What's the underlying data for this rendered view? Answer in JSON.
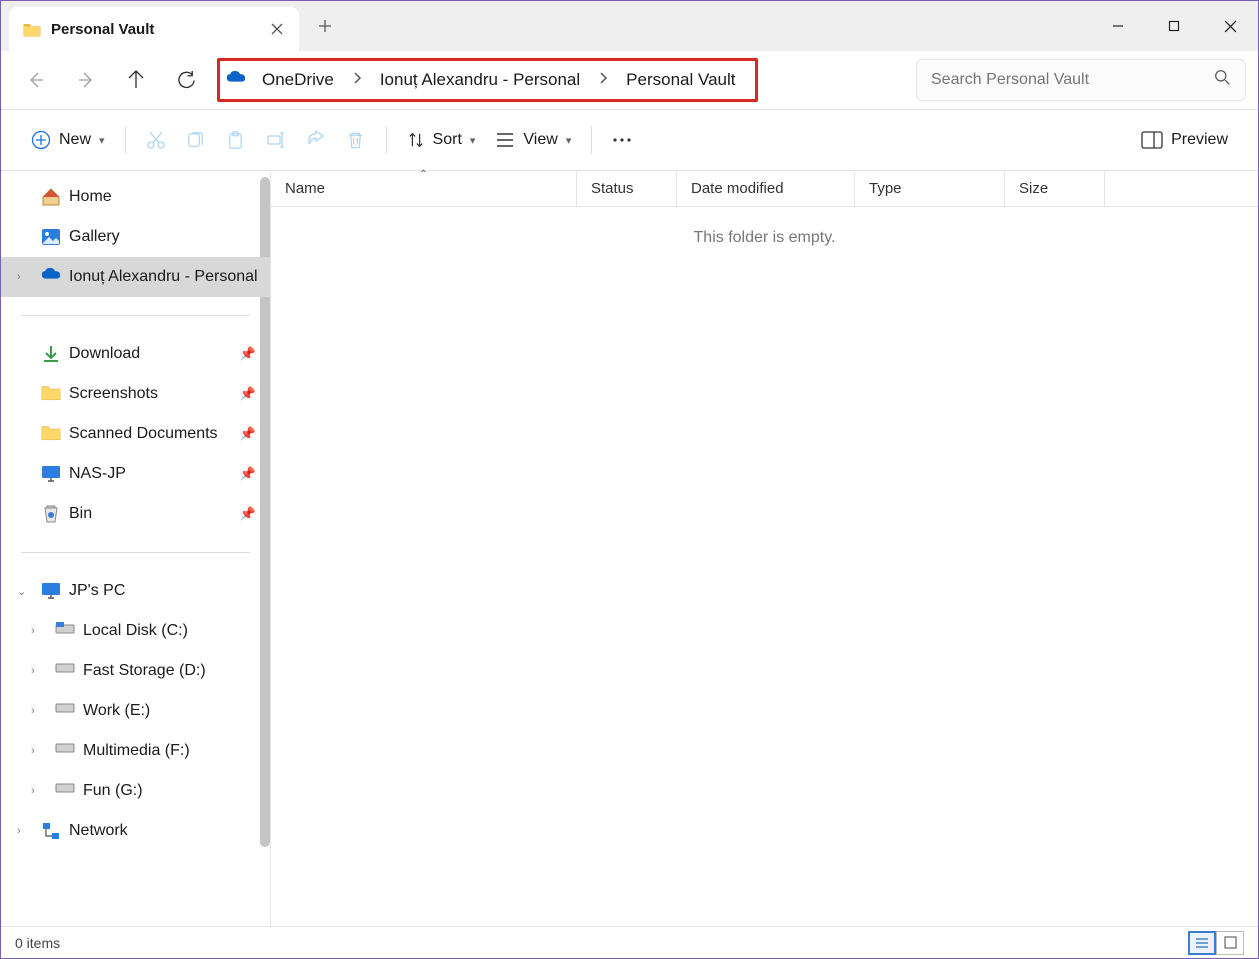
{
  "tab": {
    "title": "Personal Vault"
  },
  "breadcrumb": [
    "OneDrive",
    "Ionuț Alexandru - Personal",
    "Personal Vault"
  ],
  "search": {
    "placeholder": "Search Personal Vault"
  },
  "toolbar": {
    "new": "New",
    "sort": "Sort",
    "view": "View",
    "preview": "Preview"
  },
  "sidebar": {
    "top": [
      {
        "label": "Home",
        "icon": "home"
      },
      {
        "label": "Gallery",
        "icon": "gallery"
      },
      {
        "label": "Ionuț Alexandru - Personal",
        "icon": "onedrive",
        "selected": true,
        "expand": true
      }
    ],
    "pinned": [
      {
        "label": "Download",
        "icon": "download"
      },
      {
        "label": "Screenshots",
        "icon": "folder"
      },
      {
        "label": "Scanned Documents",
        "icon": "folder"
      },
      {
        "label": "NAS-JP",
        "icon": "monitor"
      },
      {
        "label": "Bin",
        "icon": "bin"
      }
    ],
    "pc": {
      "label": "JP's PC",
      "drives": [
        {
          "label": "Local Disk (C:)",
          "icon": "disk-os"
        },
        {
          "label": "Fast Storage (D:)",
          "icon": "disk"
        },
        {
          "label": "Work (E:)",
          "icon": "disk"
        },
        {
          "label": "Multimedia (F:)",
          "icon": "disk"
        },
        {
          "label": "Fun (G:)",
          "icon": "disk"
        }
      ]
    },
    "network": {
      "label": "Network"
    }
  },
  "columns": {
    "name": "Name",
    "status": "Status",
    "date": "Date modified",
    "type": "Type",
    "size": "Size"
  },
  "empty_text": "This folder is empty.",
  "status": "0 items"
}
